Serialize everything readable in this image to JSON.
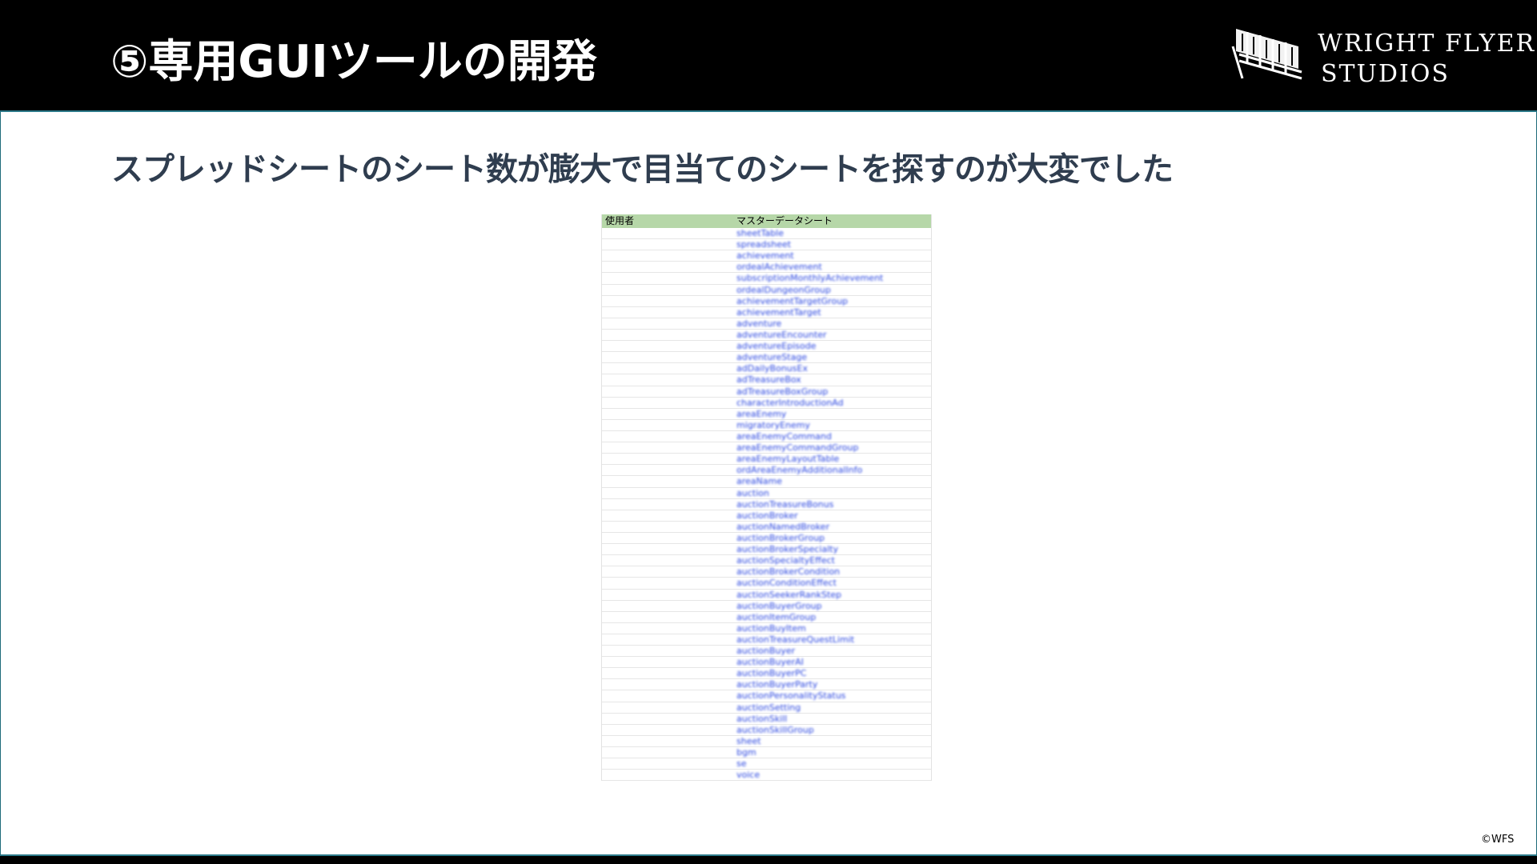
{
  "header": {
    "title": "⑤専用GUIツールの開発",
    "logo": {
      "line1": "WRIGHT FLYER",
      "line2": "STUDIOS",
      "icon": "biplane-icon"
    }
  },
  "subtitle": "スプレッドシートのシート数が膨大で目当てのシートを探すのが大変でした",
  "sheet": {
    "columns": [
      "使用者",
      "マスターデータシート"
    ],
    "header_color": "#b6d7a8",
    "link_color": "#2b47e0",
    "rows": [
      "sheetTable",
      "spreadsheet",
      "achievement",
      "ordealAchievement",
      "subscriptionMonthlyAchievement",
      "ordealDungeonGroup",
      "achievementTargetGroup",
      "achievementTarget",
      "adventure",
      "adventureEncounter",
      "adventureEpisode",
      "adventureStage",
      "adDailyBonusEx",
      "adTreasureBox",
      "adTreasureBoxGroup",
      "characterIntroductionAd",
      "areaEnemy",
      "migratoryEnemy",
      "areaEnemyCommand",
      "areaEnemyCommandGroup",
      "areaEnemyLayoutTable",
      "ordAreaEnemyAdditionalInfo",
      "areaName",
      "auction",
      "auctionTreasureBonus",
      "auctionBroker",
      "auctionNamedBroker",
      "auctionBrokerGroup",
      "auctionBrokerSpecialty",
      "auctionSpecialtyEffect",
      "auctionBrokerCondition",
      "auctionConditionEffect",
      "auctionSeekerRankStep",
      "auctionBuyerGroup",
      "auctionItemGroup",
      "auctionBuyItem",
      "auctionTreasureQuestLimit",
      "auctionBuyer",
      "auctionBuyerAI",
      "auctionBuyerPC",
      "auctionBuyerParty",
      "auctionPersonalityStatus",
      "auctionSetting",
      "auctionSkill",
      "auctionSkillGroup",
      "sheet",
      "bgm",
      "se",
      "voice"
    ]
  },
  "copyright": "©WFS"
}
